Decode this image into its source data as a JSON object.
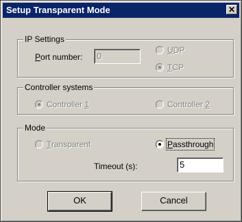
{
  "window": {
    "title": "Setup Transparent Mode",
    "close_symbol": "✕"
  },
  "ip_settings": {
    "legend": "IP Settings",
    "port_label_u": "P",
    "port_label_rest": "ort number:",
    "port_value": "0",
    "udp_u": "U",
    "udp_rest": "DP",
    "tcp_u": "T",
    "tcp_rest": "CP",
    "selected": "TCP"
  },
  "controller_systems": {
    "legend": "Controller systems",
    "c1_label": "Controller ",
    "c1_num": "1",
    "c2_label": "Controller ",
    "c2_num": "2",
    "selected": "Controller 1"
  },
  "mode": {
    "legend": "Mode",
    "transparent_u": "T",
    "transparent_rest": "ransparent",
    "passthrough_u": "P",
    "passthrough_rest": "assthrough",
    "selected": "Passthrough",
    "timeout_label": "Timeout (s):",
    "timeout_value": "5"
  },
  "buttons": {
    "ok": "OK",
    "cancel": "Cancel"
  }
}
